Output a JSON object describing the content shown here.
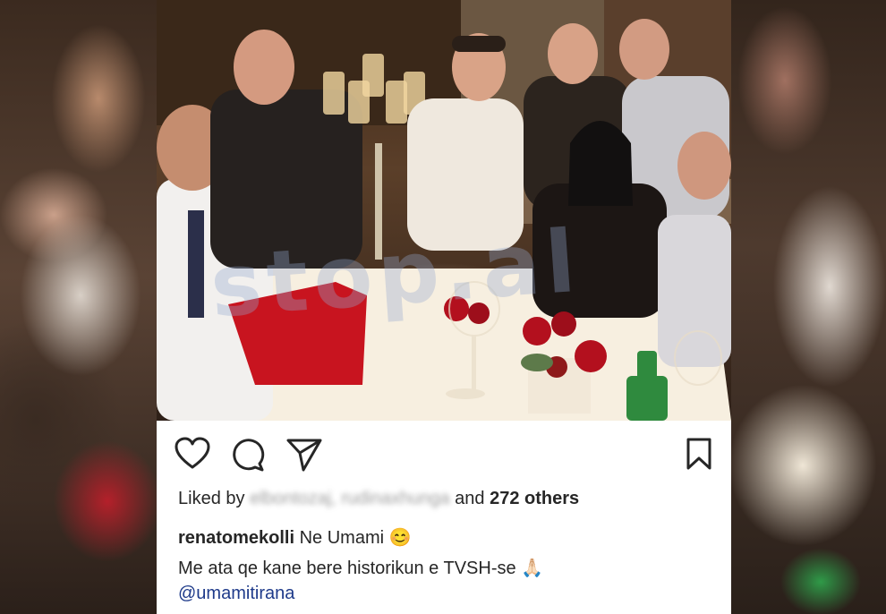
{
  "post": {
    "photo_watermark": "stop.al",
    "icons": {
      "like": "heart-icon",
      "comment": "comment-bubble-icon",
      "share": "paper-plane-icon",
      "save": "bookmark-icon"
    },
    "likes": {
      "prefix": "Liked by",
      "blurred_users": "elbontozaj, rudinaxhunga",
      "joiner": "and",
      "others": "272 others"
    },
    "caption": {
      "username": "renatomekolli",
      "text": "Ne Umami",
      "emoji": "😊"
    },
    "line2": {
      "text": "Me ata qe kane bere historikun e TVSH-se",
      "emoji": "🙏🏻"
    },
    "mention": "@umamitirana"
  }
}
